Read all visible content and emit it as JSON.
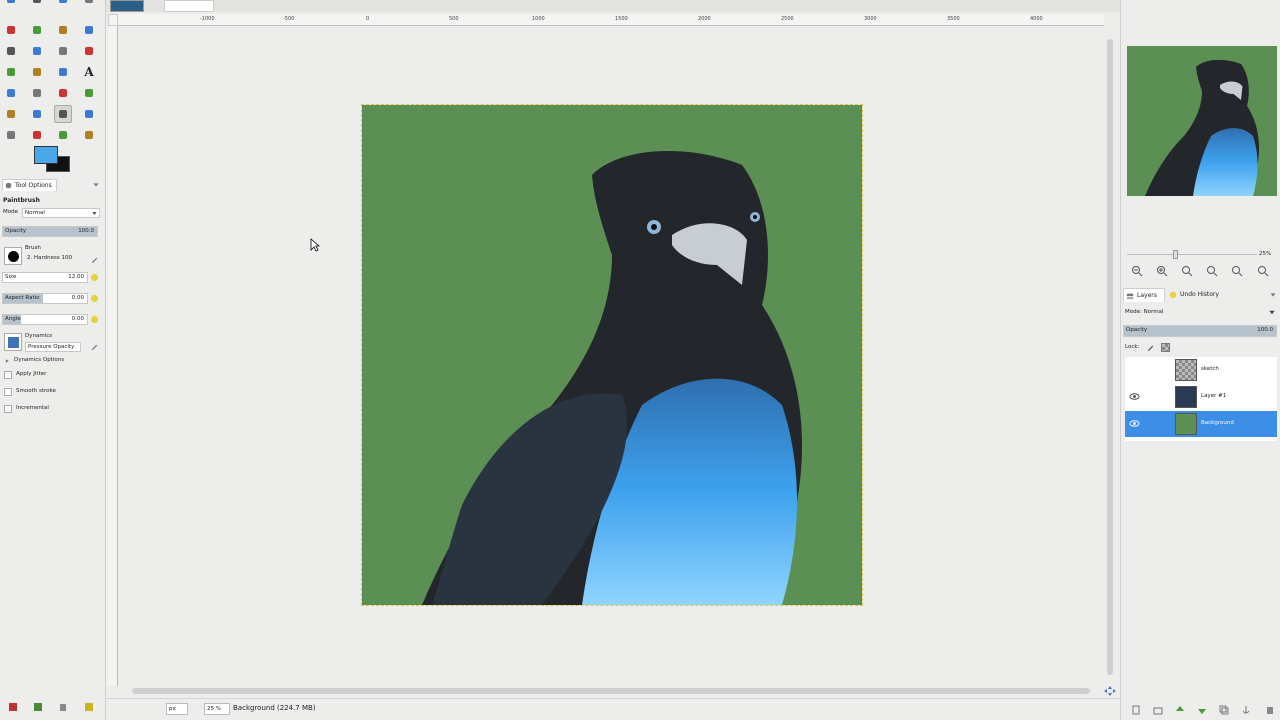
{
  "tool_options": {
    "tab_label": "Tool Options",
    "tool_name": "Paintbrush",
    "mode_label": "Mode",
    "mode_value": "Normal",
    "opacity_label": "Opacity",
    "opacity_value": "100.0",
    "opacity_fraction": 1.0,
    "brush_label": "Brush",
    "brush_name": "2. Hardness 100",
    "size_label": "Size",
    "size_value": "12.00",
    "aspect_label": "Aspect Ratio",
    "aspect_value": "0.00",
    "angle_label": "Angle",
    "angle_value": "0.00",
    "dynamics_label": "Dynamics",
    "dynamics_value": "Pressure Opacity",
    "dynamics_options_label": "Dynamics Options",
    "apply_jitter_label": "Apply Jitter",
    "smooth_stroke_label": "Smooth stroke",
    "incremental_label": "Incremental"
  },
  "colors": {
    "foreground": "#4aa8ea",
    "background": "#111111",
    "canvas_green": "#5b8f54",
    "selection_accent": "#3d8ee6"
  },
  "ruler": {
    "ticks": [
      "-1000",
      "-500",
      "0",
      "500",
      "1000",
      "1500",
      "2000",
      "2500",
      "3000",
      "3500",
      "4000"
    ]
  },
  "statusbar": {
    "unit": "px",
    "zoom": "25 %",
    "layer_info": "Background (224.7 MB)"
  },
  "navigator": {
    "zoom_value": "25%",
    "zoom_fraction": 0.35
  },
  "layers_panel": {
    "tab_layers": "Layers",
    "tab_undo": "Undo History",
    "mode_label": "Mode: Normal",
    "opacity_label": "Opacity",
    "opacity_value": "100.0",
    "lock_label": "Lock:",
    "layers": [
      {
        "name": "sketch",
        "visible": false,
        "selected": false
      },
      {
        "name": "Layer #1",
        "visible": true,
        "selected": false
      },
      {
        "name": "Background",
        "visible": true,
        "selected": true
      }
    ]
  },
  "icons": {
    "toolbox": [
      "rect-select-icon",
      "ellipse-select-icon",
      "free-select-icon",
      "fuzzy-select-icon",
      "paths-icon",
      "move-icon",
      "align-icon",
      "crop-icon",
      "rotate-icon",
      "scale-icon",
      "shear-icon",
      "perspective-icon",
      "flip-icon",
      "cage-icon",
      "warp-icon",
      "text-icon",
      "color-picker-icon",
      "zoom-icon",
      "measure-icon",
      "bucket-fill-icon",
      "gradient-icon",
      "pencil-icon",
      "paintbrush-icon",
      "eraser-icon",
      "airbrush-icon",
      "ink-icon",
      "clone-icon",
      "heal-icon",
      "smudge-icon",
      "dodge-icon",
      "blur-icon",
      "mypaint-brush-icon"
    ]
  }
}
